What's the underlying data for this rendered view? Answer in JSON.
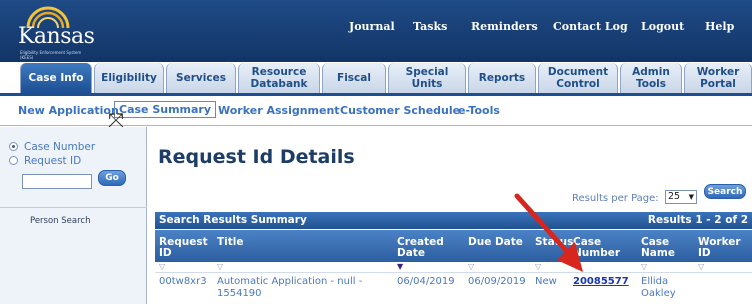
{
  "logo": {
    "word": "Kansas",
    "subtitle": "Eligibility Enforcement System (KEES)"
  },
  "top_nav": [
    "Journal",
    "Tasks",
    "Reminders",
    "Contact Log",
    "Logout",
    "Help"
  ],
  "tabs": [
    {
      "label": "Case Info",
      "active": true
    },
    {
      "label": "Eligibility"
    },
    {
      "label": "Services"
    },
    {
      "label": "Resource Databank"
    },
    {
      "label": "Fiscal"
    },
    {
      "label": "Special Units"
    },
    {
      "label": "Reports"
    },
    {
      "label": "Document Control"
    },
    {
      "label": "Admin Tools"
    },
    {
      "label": "Worker Portal"
    }
  ],
  "subnav": [
    "New Application",
    "Case Summary",
    "Worker Assignment",
    "Customer Schedule",
    "e-Tools"
  ],
  "left_panel": {
    "radio_case_number": "Case Number",
    "radio_request_id": "Request ID",
    "go_label": "Go",
    "person_search": "Person Search"
  },
  "page": {
    "title": "Request Id Details",
    "results_per_page_label": "Results per Page:",
    "results_per_page_value": "25",
    "search_label": "Search"
  },
  "results": {
    "summary_title": "Search Results Summary",
    "summary_count": "Results 1 - 2 of 2",
    "columns": [
      "Request ID",
      "Title",
      "Created Date",
      "Due Date",
      "Status",
      "Case Number",
      "Case Name",
      "Worker ID"
    ],
    "rows": [
      {
        "request_id": "00tw8xr3",
        "title": "Automatic Application - null - 1554190",
        "created": "06/04/2019",
        "due": "06/09/2019",
        "status": "New",
        "case_number": "20085577",
        "case_name": "Ellida Oakley",
        "worker_id": ""
      }
    ]
  },
  "colors": {
    "brand_blue": "#1c4f92",
    "annotation_red": "#d7261e"
  }
}
